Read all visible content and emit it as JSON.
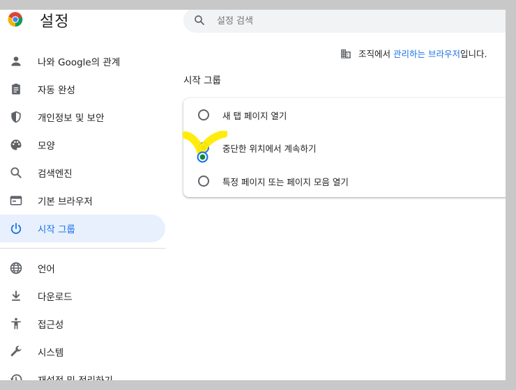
{
  "header": {
    "title": "설정",
    "search_placeholder": "설정 검색"
  },
  "sidebar": {
    "items": [
      {
        "label": "나와 Google의 관계",
        "icon": "person-icon"
      },
      {
        "label": "자동 완성",
        "icon": "clipboard-icon"
      },
      {
        "label": "개인정보 및 보안",
        "icon": "shield-icon"
      },
      {
        "label": "모양",
        "icon": "palette-icon"
      },
      {
        "label": "검색엔진",
        "icon": "search-icon"
      },
      {
        "label": "기본 브라우저",
        "icon": "browser-window-icon"
      },
      {
        "label": "시작 그룹",
        "icon": "power-icon",
        "active": true
      },
      {
        "label": "언어",
        "icon": "globe-icon"
      },
      {
        "label": "다운로드",
        "icon": "download-icon"
      },
      {
        "label": "접근성",
        "icon": "accessibility-icon"
      },
      {
        "label": "시스템",
        "icon": "wrench-icon"
      },
      {
        "label": "재설정 및 정리하기",
        "icon": "restore-icon"
      }
    ]
  },
  "managed_notice": {
    "prefix": "조직에서 ",
    "link": "관리하는 브라우저",
    "suffix": "입니다."
  },
  "startup": {
    "section_title": "시작 그룹",
    "options": [
      {
        "label": "새 탭 페이지 열기",
        "checked": false
      },
      {
        "label": "중단한 위치에서 계속하기",
        "checked": true
      },
      {
        "label": "특정 페이지 또는 페이지 모음 열기",
        "checked": false
      }
    ]
  },
  "colors": {
    "accent": "#1a73e8",
    "active_bg": "#e8f0fe",
    "highlight_marker": "#ffeb00"
  }
}
